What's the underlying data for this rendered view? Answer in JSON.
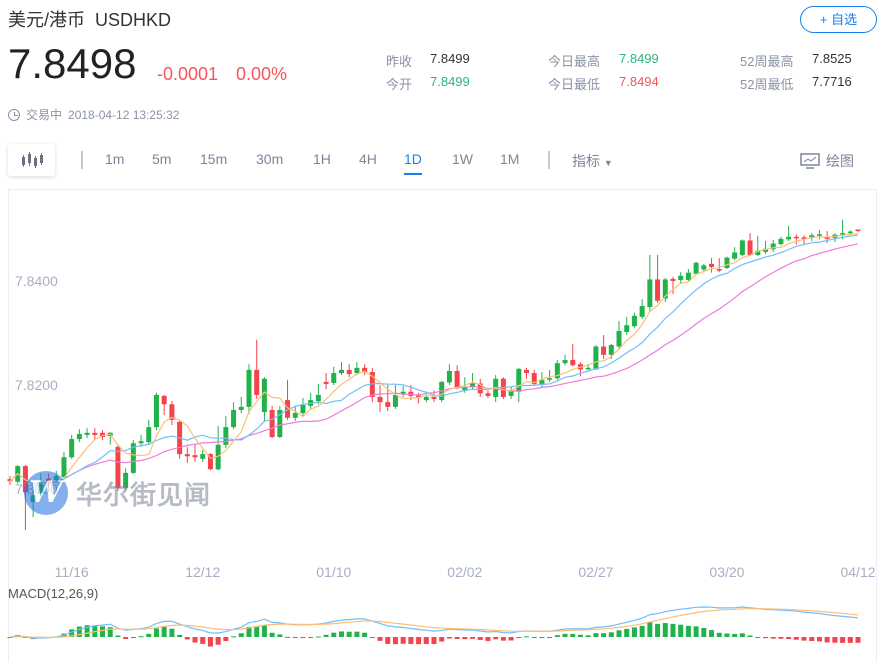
{
  "header": {
    "name": "美元/港币",
    "symbol": "USDHKD",
    "price": "7.8498",
    "change": "-0.0001",
    "change_pct": "0.00%",
    "add_watchlist": "+ 自选",
    "status": "交易中",
    "datetime": "2018-04-12 13:25:32"
  },
  "stats": [
    {
      "label": "昨收",
      "value": "7.8499",
      "color": "neutral"
    },
    {
      "label": "今开",
      "value": "7.8499",
      "color": "green"
    },
    {
      "label": "今日最高",
      "value": "7.8499",
      "color": "green"
    },
    {
      "label": "今日最低",
      "value": "7.8494",
      "color": "red"
    },
    {
      "label": "52周最高",
      "value": "7.8525",
      "color": "neutral"
    },
    {
      "label": "52周最低",
      "value": "7.7716",
      "color": "neutral"
    }
  ],
  "toolbar": {
    "chart_type_icon": "candlestick-icon",
    "timeframes": [
      "1m",
      "5m",
      "15m",
      "30m",
      "1H",
      "4H",
      "1D",
      "1W",
      "1M"
    ],
    "active": "1D",
    "indicators": "指标",
    "draw": "绘图"
  },
  "colors": {
    "up": "#21b24b",
    "down": "#f5434b",
    "ma5": "#fdbf74",
    "ma10": "#73bef9",
    "ma20": "#f27ad9",
    "accent": "#1a7ff0"
  },
  "watermark": {
    "text": "华尔街见闻",
    "logo": "W"
  },
  "chart_data": {
    "type": "candlestick",
    "ylim": [
      7.788,
      7.8535
    ],
    "yticks": [
      "7.8400",
      "7.8200",
      "7.8000"
    ],
    "xticks": [
      {
        "label": "11/16",
        "index": 8
      },
      {
        "label": "12/12",
        "index": 25
      },
      {
        "label": "01/10",
        "index": 42
      },
      {
        "label": "02/02",
        "index": 59
      },
      {
        "label": "02/27",
        "index": 76
      },
      {
        "label": "03/20",
        "index": 93
      },
      {
        "label": "04/12",
        "index": 110
      }
    ],
    "moving_averages": [
      5,
      10,
      20
    ],
    "macd_label": "MACD(12,26,9)",
    "ohlc": [
      [
        7.8019,
        7.8025,
        7.8008,
        7.8015
      ],
      [
        7.8014,
        7.8046,
        7.801,
        7.8044
      ],
      [
        7.8044,
        7.8046,
        7.7921,
        7.7994
      ],
      [
        7.7975,
        7.7996,
        7.7946,
        7.7988
      ],
      [
        7.7992,
        7.803,
        7.7985,
        7.8013
      ],
      [
        7.802,
        7.803,
        7.8005,
        7.8015
      ],
      [
        7.8017,
        7.8035,
        7.8012,
        7.8025
      ],
      [
        7.8023,
        7.8071,
        7.8019,
        7.8061
      ],
      [
        7.8061,
        7.8104,
        7.8058,
        7.8096
      ],
      [
        7.8096,
        7.8115,
        7.809,
        7.8106
      ],
      [
        7.8104,
        7.8117,
        7.8098,
        7.8108
      ],
      [
        7.8108,
        7.8117,
        7.8094,
        7.8104
      ],
      [
        7.8108,
        7.8113,
        7.8094,
        7.81
      ],
      [
        7.8102,
        7.811,
        7.8085,
        7.8108
      ],
      [
        7.8081,
        7.8085,
        7.7996,
        7.8002
      ],
      [
        7.8002,
        7.804,
        7.7998,
        7.8031
      ],
      [
        7.8031,
        7.8094,
        7.8029,
        7.8088
      ],
      [
        7.8088,
        7.8104,
        7.8081,
        7.8092
      ],
      [
        7.809,
        7.8133,
        7.8085,
        7.8119
      ],
      [
        7.8119,
        7.8185,
        7.8113,
        7.8181
      ],
      [
        7.8179,
        7.8181,
        7.8142,
        7.8163
      ],
      [
        7.8163,
        7.8169,
        7.8123,
        7.8133
      ],
      [
        7.8129,
        7.8131,
        7.8058,
        7.8067
      ],
      [
        7.8067,
        7.8081,
        7.805,
        7.8063
      ],
      [
        7.8065,
        7.8085,
        7.8052,
        7.8061
      ],
      [
        7.8058,
        7.8075,
        7.8052,
        7.8067
      ],
      [
        7.8067,
        7.8069,
        7.8036,
        7.8038
      ],
      [
        7.8038,
        7.8121,
        7.8036,
        7.8085
      ],
      [
        7.8085,
        7.814,
        7.8079,
        7.8119
      ],
      [
        7.8119,
        7.8167,
        7.8115,
        7.8152
      ],
      [
        7.8152,
        7.8177,
        7.8146,
        7.8158
      ],
      [
        7.8158,
        7.824,
        7.8144,
        7.8229
      ],
      [
        7.8229,
        7.8287,
        7.8173,
        7.8181
      ],
      [
        7.8148,
        7.8215,
        7.8129,
        7.8212
      ],
      [
        7.8152,
        7.816,
        7.8098,
        7.81
      ],
      [
        7.81,
        7.816,
        7.8098,
        7.8152
      ],
      [
        7.8171,
        7.821,
        7.8133,
        7.8137
      ],
      [
        7.8137,
        7.816,
        7.8131,
        7.8146
      ],
      [
        7.8146,
        7.8175,
        7.814,
        7.8162
      ],
      [
        7.816,
        7.8185,
        7.8154,
        7.8171
      ],
      [
        7.8169,
        7.8202,
        7.8163,
        7.8181
      ],
      [
        7.8206,
        7.8223,
        7.8192,
        7.8202
      ],
      [
        7.8204,
        7.8235,
        7.82,
        7.8223
      ],
      [
        7.8223,
        7.8244,
        7.8219,
        7.8229
      ],
      [
        7.8229,
        7.824,
        7.8215,
        7.8221
      ],
      [
        7.8223,
        7.8244,
        7.8219,
        7.8233
      ],
      [
        7.8233,
        7.824,
        7.8219,
        7.8225
      ],
      [
        7.8225,
        7.8233,
        7.8167,
        7.8177
      ],
      [
        7.8177,
        7.82,
        7.8148,
        7.8167
      ],
      [
        7.8167,
        7.82,
        7.815,
        7.8158
      ],
      [
        7.8158,
        7.82,
        7.8154,
        7.8181
      ],
      [
        7.8183,
        7.8198,
        7.8177,
        7.8187
      ],
      [
        7.8187,
        7.82,
        7.8171,
        7.8179
      ],
      [
        7.818,
        7.8185,
        7.8165,
        7.8176
      ],
      [
        7.8171,
        7.8187,
        7.8167,
        7.8177
      ],
      [
        7.8177,
        7.819,
        7.8167,
        7.8173
      ],
      [
        7.8171,
        7.8208,
        7.8167,
        7.8206
      ],
      [
        7.8205,
        7.824,
        7.82,
        7.8227
      ],
      [
        7.8227,
        7.8238,
        7.8192,
        7.8194
      ],
      [
        7.819,
        7.8215,
        7.8185,
        7.8196
      ],
      [
        7.8196,
        7.8223,
        7.8192,
        7.8203
      ],
      [
        7.8203,
        7.8212,
        7.8177,
        7.8184
      ],
      [
        7.8184,
        7.819,
        7.8175,
        7.8179
      ],
      [
        7.8177,
        7.8219,
        7.8167,
        7.8212
      ],
      [
        7.8212,
        7.8215,
        7.8173,
        7.8177
      ],
      [
        7.8179,
        7.8196,
        7.8173,
        7.819
      ],
      [
        7.8187,
        7.8233,
        7.8167,
        7.8231
      ],
      [
        7.8229,
        7.8233,
        7.8212,
        7.8223
      ],
      [
        7.8223,
        7.8229,
        7.8198,
        7.8202
      ],
      [
        7.82,
        7.8225,
        7.8196,
        7.821
      ],
      [
        7.821,
        7.8229,
        7.8206,
        7.8213
      ],
      [
        7.8213,
        7.8248,
        7.821,
        7.8242
      ],
      [
        7.8242,
        7.8258,
        7.8238,
        7.8248
      ],
      [
        7.8248,
        7.8279,
        7.8236,
        7.8238
      ],
      [
        7.824,
        7.8244,
        7.8217,
        7.823
      ],
      [
        7.823,
        7.824,
        7.8229,
        7.8233
      ],
      [
        7.823,
        7.8277,
        7.8229,
        7.8274
      ],
      [
        7.8274,
        7.8296,
        7.825,
        7.8258
      ],
      [
        7.8258,
        7.8279,
        7.825,
        7.8277
      ],
      [
        7.8274,
        7.8323,
        7.827,
        7.8304
      ],
      [
        7.8302,
        7.8331,
        7.8296,
        7.8315
      ],
      [
        7.8313,
        7.8339,
        7.831,
        7.8333
      ],
      [
        7.8331,
        7.8365,
        7.8327,
        7.8352
      ],
      [
        7.835,
        7.845,
        7.8342,
        7.8403
      ],
      [
        7.8403,
        7.845,
        7.8358,
        7.8362
      ],
      [
        7.8366,
        7.8406,
        7.836,
        7.8403
      ],
      [
        7.8404,
        7.8408,
        7.8375,
        7.84
      ],
      [
        7.8402,
        7.8417,
        7.8394,
        7.841
      ],
      [
        7.8402,
        7.8423,
        7.84,
        7.8416
      ],
      [
        7.8414,
        7.8437,
        7.8412,
        7.8435
      ],
      [
        7.8422,
        7.8433,
        7.8417,
        7.843
      ],
      [
        7.8433,
        7.8444,
        7.8416,
        7.8427
      ],
      [
        7.8423,
        7.8444,
        7.8417,
        7.842
      ],
      [
        7.8425,
        7.8447,
        7.8423,
        7.8445
      ],
      [
        7.8443,
        7.8465,
        7.844,
        7.8455
      ],
      [
        7.845,
        7.848,
        7.8448,
        7.8478
      ],
      [
        7.8478,
        7.8492,
        7.8448,
        7.845
      ],
      [
        7.845,
        7.8487,
        7.8448,
        7.8458
      ],
      [
        7.8456,
        7.8477,
        7.8452,
        7.8462
      ],
      [
        7.8461,
        7.8479,
        7.8456,
        7.8472
      ],
      [
        7.8471,
        7.8485,
        7.8468,
        7.8481
      ],
      [
        7.848,
        7.8506,
        7.8477,
        7.8485
      ],
      [
        7.8485,
        7.849,
        7.847,
        7.8482
      ],
      [
        7.8484,
        7.8488,
        7.8469,
        7.8481
      ],
      [
        7.8484,
        7.8492,
        7.8477,
        7.8488
      ],
      [
        7.8487,
        7.8498,
        7.848,
        7.849
      ],
      [
        7.8485,
        7.8496,
        7.8473,
        7.8481
      ],
      [
        7.8483,
        7.8492,
        7.8475,
        7.8489
      ],
      [
        7.849,
        7.8518,
        7.848,
        7.8492
      ],
      [
        7.8492,
        7.8498,
        7.849,
        7.8495
      ],
      [
        7.8499,
        7.8499,
        7.8494,
        7.8498
      ]
    ]
  }
}
